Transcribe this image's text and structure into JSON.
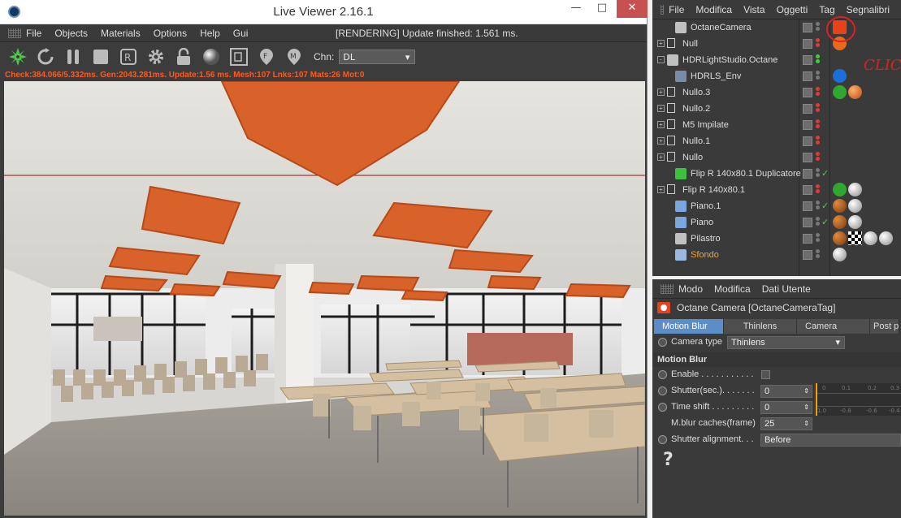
{
  "live_viewer": {
    "title": "Live Viewer 2.16.1",
    "window_buttons": {
      "minimize": "—",
      "maximize": "□",
      "close": "✕"
    },
    "menu": [
      "File",
      "Objects",
      "Materials",
      "Options",
      "Help",
      "Gui"
    ],
    "status": "[RENDERING] Update finished: 1.561 ms.",
    "toolbar_icons": [
      "octane-icon",
      "refresh-icon",
      "pause-icon",
      "stop-icon",
      "region-icon",
      "settings-icon",
      "lock-icon",
      "material-ball-icon",
      "film-region-icon",
      "focus-picker-icon",
      "material-picker-icon"
    ],
    "channel_label": "Chn:",
    "channel_value": "DL",
    "stats": "Check:384.066/5.332ms. Gen:2043.281ms. Update:1.56 ms. Mesh:107 Lnks:107 Mats:26 Mot:0"
  },
  "object_manager": {
    "menu": [
      "File",
      "Modifica",
      "Vista",
      "Oggetti",
      "Tag",
      "Segnalibri"
    ],
    "annotation": "CLICK",
    "objects": [
      {
        "name": "OctaneCamera",
        "icon": "camera-icon",
        "indent": 1,
        "tags": [
          "octane-camera-tag"
        ]
      },
      {
        "name": "Null",
        "icon": "null-icon",
        "indent": 0,
        "expand": "+",
        "tags": [
          "hdr-tag"
        ]
      },
      {
        "name": "HDRLightStudio.Octane",
        "icon": "hdr-icon",
        "indent": 0,
        "expand": "-",
        "tags": []
      },
      {
        "name": "HDRLS_Env",
        "icon": "env-icon",
        "indent": 1,
        "tags": [
          "env-tag"
        ]
      },
      {
        "name": "Nullo.3",
        "icon": "null-icon",
        "indent": 0,
        "expand": "+",
        "tags": [
          "green-tag",
          "orange-tag"
        ]
      },
      {
        "name": "Nullo.2",
        "icon": "null-icon",
        "indent": 0,
        "expand": "+",
        "tags": []
      },
      {
        "name": "M5 Impilate",
        "icon": "null-icon",
        "indent": 0,
        "expand": "+",
        "tags": []
      },
      {
        "name": "Nullo.1",
        "icon": "null-icon",
        "indent": 0,
        "expand": "+",
        "tags": []
      },
      {
        "name": "Nullo",
        "icon": "null-icon",
        "indent": 0,
        "expand": "+",
        "tags": []
      },
      {
        "name": "Flip R 140x80.1 Duplicatore",
        "icon": "cloner-icon",
        "indent": 1,
        "check": "✓",
        "tags": []
      },
      {
        "name": "Flip R 140x80.1",
        "icon": "null-icon",
        "indent": 0,
        "expand": "+",
        "tags": [
          "green-tag",
          "white-tag"
        ]
      },
      {
        "name": "Piano.1",
        "icon": "plane-icon",
        "indent": 1,
        "check": "✓",
        "tags": [
          "multi-tag",
          "white-tag"
        ]
      },
      {
        "name": "Piano",
        "icon": "plane-icon",
        "indent": 1,
        "check": "✓",
        "tags": [
          "multi-tag",
          "white-tag"
        ]
      },
      {
        "name": "Pilastro",
        "icon": "pillar-icon",
        "indent": 1,
        "tags": [
          "multi-tag",
          "checker-tag",
          "white-tag",
          "white-tag"
        ]
      },
      {
        "name": "Sfondo",
        "icon": "background-icon",
        "indent": 1,
        "highlight": true,
        "tags": [
          "gray-tag"
        ]
      }
    ]
  },
  "attribute_manager": {
    "menu": [
      "Modo",
      "Modifica",
      "Dati Utente"
    ],
    "header": "Octane Camera [OctaneCameraTag]",
    "tabs": [
      "Motion Blur",
      "Thinlens",
      "Camera Imager",
      "Post p"
    ],
    "camera_type_label": "Camera type",
    "camera_type_value": "Thinlens",
    "section": "Motion Blur",
    "enable_label": "Enable . . . . . . . . . . .",
    "shutter_label": "Shutter(sec.). . . . . . .",
    "shutter_value": "0",
    "timeshift_label": "Time shift . . . . . . . . .",
    "timeshift_value": "0",
    "caches_label": "M.blur caches(frame)",
    "caches_value": "25",
    "alignment_label": "Shutter alignment. . .",
    "alignment_value": "Before",
    "graph_ticks_top": [
      "0",
      "0.1",
      "0.2",
      "0.3"
    ],
    "graph_ticks_bottom": [
      "1.0",
      "-0.8",
      "-0.6",
      "-0.4"
    ],
    "help": "?"
  },
  "colors": {
    "accent_blue": "#5b8ec7",
    "stats_orange": "#ff5a1e",
    "ceiling_orange": "#d8622a",
    "annotation_red": "#e02020"
  }
}
